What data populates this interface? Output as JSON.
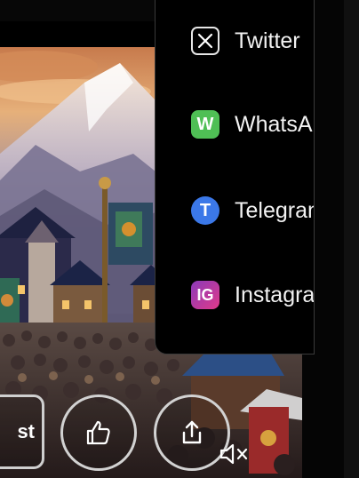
{
  "share_menu": {
    "items": [
      {
        "label": "Twitter",
        "icon": "x-logo-icon",
        "color": "#000000"
      },
      {
        "label": "WhatsApp",
        "icon": "whatsapp-icon",
        "icon_text": "W",
        "color": "#4fbf55"
      },
      {
        "label": "Telegram",
        "icon": "telegram-icon",
        "icon_text": "T",
        "color": "#3b78e8"
      },
      {
        "label": "Instagram",
        "icon": "instagram-icon",
        "icon_text": "IG",
        "color": "#c13ab0"
      }
    ]
  },
  "actions": {
    "partial_button_label": "st",
    "like_icon": "thumbs-up-icon",
    "share_icon": "share-icon",
    "mute_icon": "muted-speaker-icon"
  }
}
